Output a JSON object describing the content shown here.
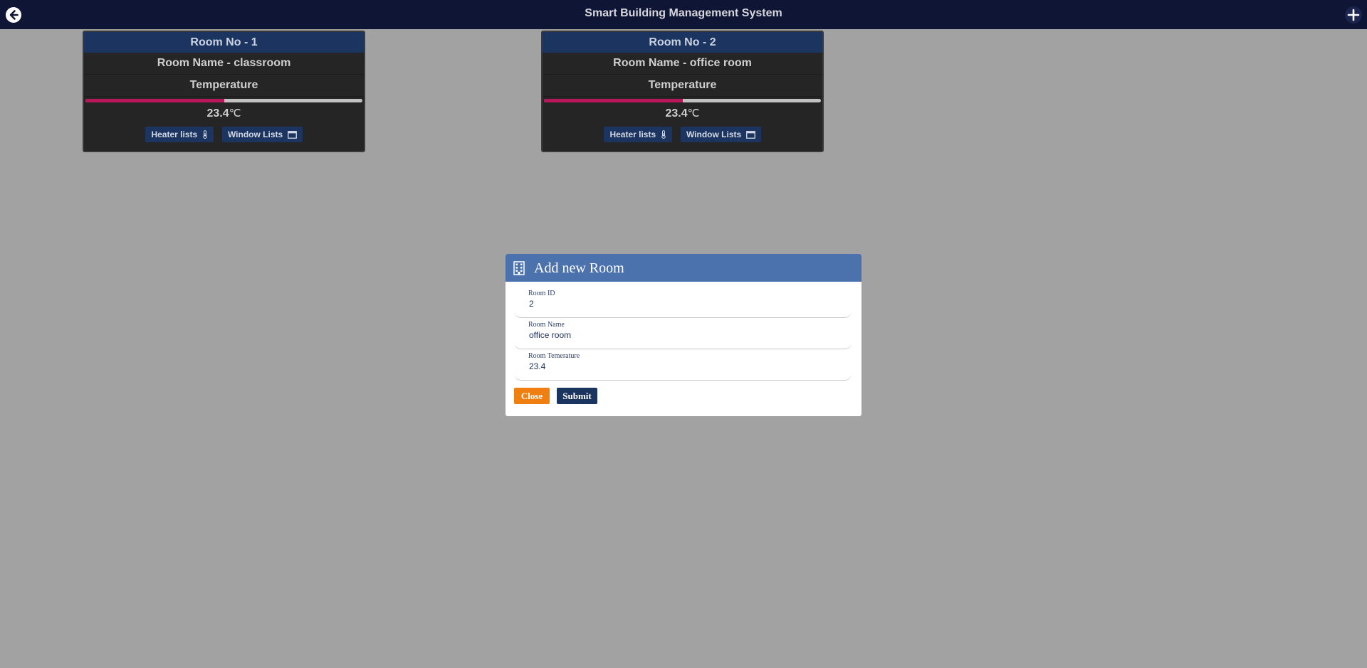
{
  "header": {
    "title": "Smart Building Management System",
    "back_icon": "arrow-left-circle-icon",
    "add_icon": "plus-icon"
  },
  "rooms": [
    {
      "room_no": "Room No - 1",
      "room_name": "Room Name - classroom",
      "temperature_label": "Temperature",
      "temperature_value": "23.4",
      "temperature_unit": "℃",
      "temperature_fill_fraction": 0.5,
      "heater_label": "Heater lists",
      "window_label": "Window Lists"
    },
    {
      "room_no": "Room No - 2",
      "room_name": "Room Name - office room",
      "temperature_label": "Temperature",
      "temperature_value": "23.4",
      "temperature_unit": "℃",
      "temperature_fill_fraction": 0.5,
      "heater_label": "Heater lists",
      "window_label": "Window Lists"
    }
  ],
  "modal": {
    "title": "Add new Room",
    "icon": "building-icon",
    "fields": [
      {
        "label": "Room ID",
        "value": "2"
      },
      {
        "label": "Room Name",
        "value": "office room"
      },
      {
        "label": "Room Temerature",
        "value": "23.4"
      }
    ],
    "close_label": "Close",
    "submit_label": "Submit"
  },
  "colors": {
    "header_bg": "#0f1534",
    "card_bg": "#252525",
    "card_head_bg": "#1c3460",
    "bar_fill": "#b8185a",
    "modal_head_bg": "#4b72ad",
    "close_btn": "#f07f12",
    "submit_btn": "#1c3460",
    "backdrop": "#a2a2a2"
  }
}
